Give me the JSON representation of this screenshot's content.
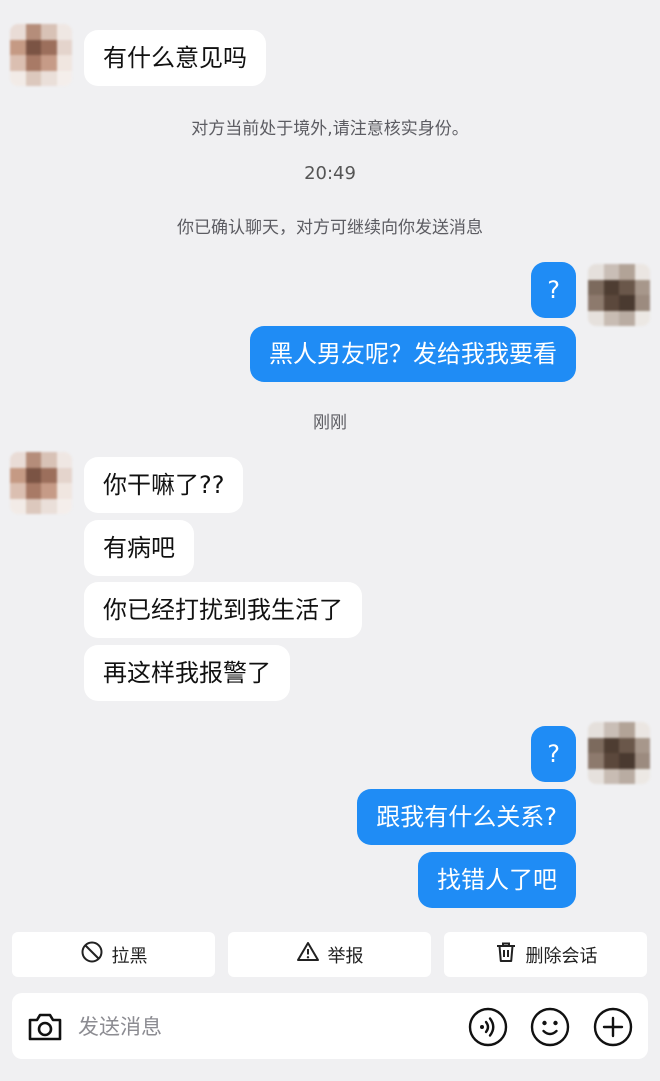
{
  "messages": {
    "m1": "有什么意见吗",
    "m2": "?",
    "m3": "黑人男友呢？发给我我要看",
    "m4": "你干嘛了??",
    "m5": "有病吧",
    "m6": "你已经打扰到我生活了",
    "m7": "再这样我报警了",
    "m8": "?",
    "m9": "跟我有什么关系?",
    "m10": "找错人了吧"
  },
  "system": {
    "abroad_notice": "对方当前处于境外,请注意核实身份。",
    "time_1": "20:49",
    "confirm_notice": "你已确认聊天，对方可继续向你发送消息",
    "time_2": "刚刚"
  },
  "actions": {
    "block_label": "拉黑",
    "report_label": "举报",
    "delete_label": "删除会话"
  },
  "input": {
    "placeholder": "发送消息"
  },
  "icons": {
    "camera": "camera-icon",
    "voice": "voice-icon",
    "emoji": "emoji-icon",
    "plus": "plus-icon",
    "block": "block-icon",
    "report": "warning-icon",
    "delete": "trash-icon"
  },
  "colors": {
    "background": "#f0f0f2",
    "outgoing_bubble": "#1f8cf5",
    "incoming_bubble": "#ffffff"
  }
}
